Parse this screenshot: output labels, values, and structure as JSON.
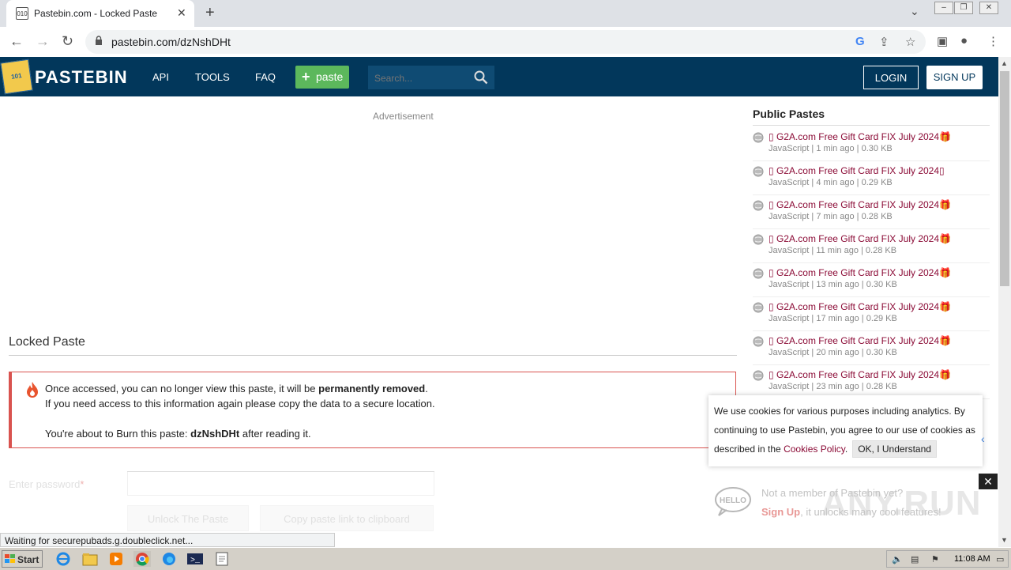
{
  "browser": {
    "tab_title": "Pastebin.com - Locked Paste",
    "tab_favicon_text": "010",
    "url": "pastebin.com/dzNshDHt",
    "status_text": "Waiting for securepubads.g.doubleclick.net..."
  },
  "header": {
    "brand": "PASTEBIN",
    "nav": [
      "API",
      "TOOLS",
      "FAQ"
    ],
    "paste_label": "paste",
    "search_placeholder": "Search...",
    "login": "LOGIN",
    "signup": "SIGN UP",
    "colors": {
      "header_bg": "#02375b",
      "paste_btn": "#5cb85c"
    }
  },
  "main": {
    "ad_label": "Advertisement",
    "title": "Locked Paste",
    "notice": {
      "line1_prefix": "Once accessed, you can no longer view this paste, it will be ",
      "line1_bold": "permanently removed",
      "line1_suffix": ".",
      "line2": "If you need access to this information again please copy the data to a secure location.",
      "line3_prefix": "You're about to Burn this paste: ",
      "line3_bold": "dzNshDHt",
      "line3_suffix": " after reading it."
    },
    "password_label": "Enter password",
    "password_required_mark": "*",
    "unlock_button": "Unlock The Paste",
    "copy_button": "Copy paste link to clipboard"
  },
  "sidebar": {
    "title": "Public Pastes",
    "items": [
      {
        "title": "▯ G2A.com Free Gift Card FIX July 2024🎁",
        "meta": "JavaScript | 1 min ago | 0.30 KB"
      },
      {
        "title": "▯ G2A.com Free Gift Card FIX July 2024▯",
        "meta": "JavaScript | 4 min ago | 0.29 KB"
      },
      {
        "title": "▯ G2A.com Free Gift Card FIX July 2024🎁",
        "meta": "JavaScript | 7 min ago | 0.28 KB"
      },
      {
        "title": "▯ G2A.com Free Gift Card FIX July 2024🎁",
        "meta": "JavaScript | 11 min ago | 0.28 KB"
      },
      {
        "title": "▯ G2A.com Free Gift Card FIX July 2024🎁",
        "meta": "JavaScript | 13 min ago | 0.30 KB"
      },
      {
        "title": "▯ G2A.com Free Gift Card FIX July 2024🎁",
        "meta": "JavaScript | 17 min ago | 0.29 KB"
      },
      {
        "title": "▯ G2A.com Free Gift Card FIX July 2024🎁",
        "meta": "JavaScript | 20 min ago | 0.30 KB"
      },
      {
        "title": "▯ G2A.com Free Gift Card FIX July 2024🎁",
        "meta": "JavaScript | 23 min ago | 0.28 KB"
      }
    ]
  },
  "cookie": {
    "text_prefix": "We use cookies for various purposes including analytics. By continuing to use Pastebin, you agree to our use of cookies as described in the ",
    "link": "Cookies Policy",
    "text_suffix": ".",
    "ok": "OK, I Understand"
  },
  "promo": {
    "hello": "HELLO",
    "line1": "Not a member of Pastebin yet?",
    "signup": "Sign Up",
    "line2_suffix": ", it unlocks many cool features!",
    "watermark": "ANY.RUN"
  },
  "taskbar": {
    "start": "Start",
    "clock": "11:08 AM"
  }
}
